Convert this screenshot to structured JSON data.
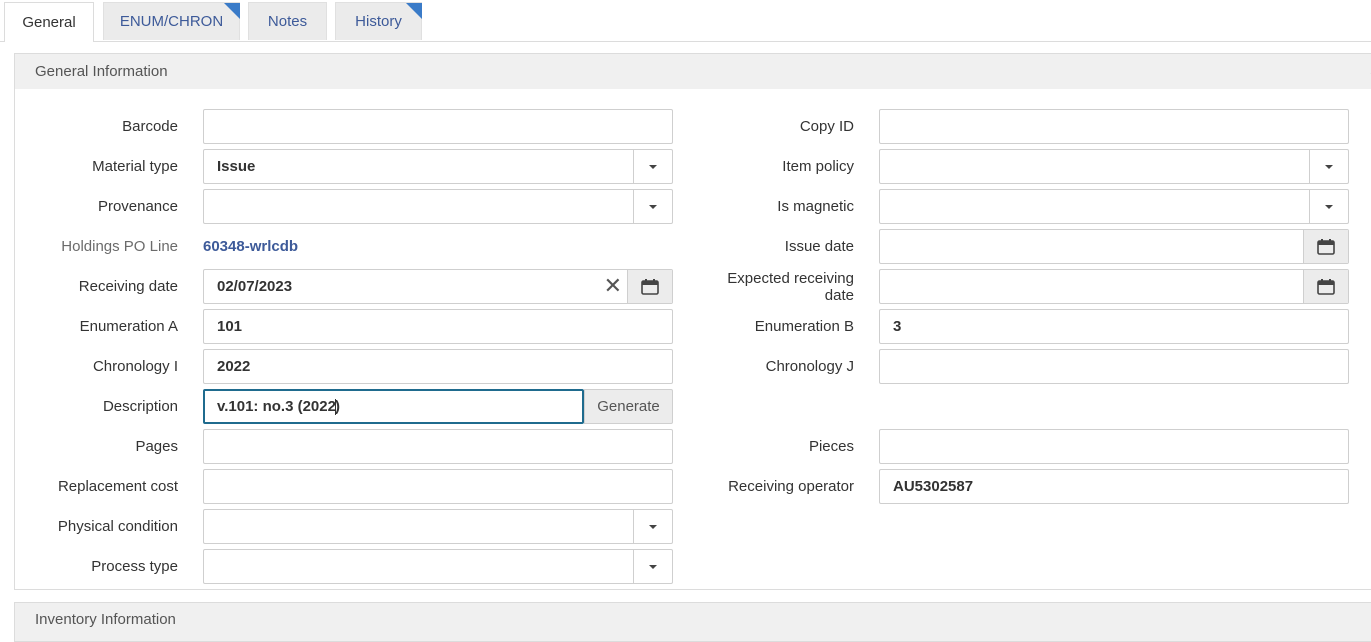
{
  "tabs": [
    {
      "label": "General",
      "active": true
    },
    {
      "label": "ENUM/CHRON",
      "flag": true
    },
    {
      "label": "Notes"
    },
    {
      "label": "History",
      "flag": true
    }
  ],
  "sections": {
    "general": "General Information",
    "inventory": "Inventory Information"
  },
  "fields": {
    "barcode": {
      "label": "Barcode",
      "value": ""
    },
    "material_type": {
      "label": "Material type",
      "value": "Issue"
    },
    "provenance": {
      "label": "Provenance",
      "value": ""
    },
    "holdings_po_line": {
      "label": "Holdings PO Line",
      "value": "60348-wrlcdb"
    },
    "receiving_date": {
      "label": "Receiving date",
      "value": "02/07/2023"
    },
    "enumeration_a": {
      "label": "Enumeration A",
      "value": "101"
    },
    "chronology_i": {
      "label": "Chronology I",
      "value": "2022"
    },
    "description": {
      "label": "Description",
      "value_before": "v.101: no.3 (2022",
      "value_after": ")"
    },
    "pages": {
      "label": "Pages",
      "value": ""
    },
    "replacement_cost": {
      "label": "Replacement cost",
      "value": ""
    },
    "physical_condition": {
      "label": "Physical condition",
      "value": ""
    },
    "process_type": {
      "label": "Process type",
      "value": ""
    },
    "copy_id": {
      "label": "Copy ID",
      "value": ""
    },
    "item_policy": {
      "label": "Item policy",
      "value": ""
    },
    "is_magnetic": {
      "label": "Is magnetic",
      "value": ""
    },
    "issue_date": {
      "label": "Issue date",
      "value": ""
    },
    "expected_receiving_date": {
      "label": "Expected receiving date",
      "value": ""
    },
    "enumeration_b": {
      "label": "Enumeration B",
      "value": "3"
    },
    "chronology_j": {
      "label": "Chronology J",
      "value": ""
    },
    "pieces": {
      "label": "Pieces",
      "value": ""
    },
    "receiving_operator": {
      "label": "Receiving operator",
      "value": "AU5302587"
    }
  },
  "buttons": {
    "generate": "Generate"
  },
  "icons": {
    "dropdown": "chevron-down-icon",
    "calendar": "calendar-icon",
    "clear": "close-icon",
    "collapse": "chevron-down-icon"
  },
  "colors": {
    "link": "#3d5a99",
    "flag": "#3a7bc8",
    "focus": "#1f6b8e"
  }
}
